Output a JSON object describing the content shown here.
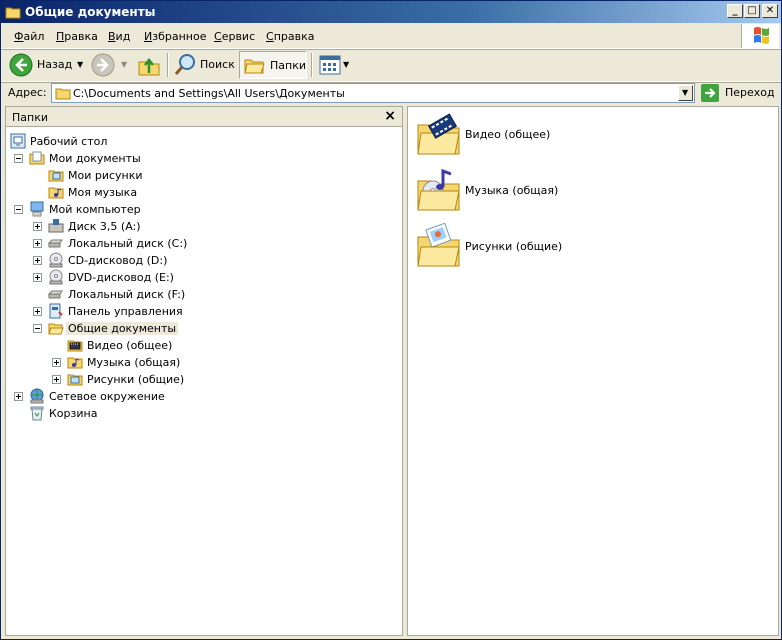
{
  "window": {
    "title": "Общие документы"
  },
  "menu": [
    "Файл",
    "Правка",
    "Вид",
    "Избранное",
    "Сервис",
    "Справка"
  ],
  "toolbar": {
    "back_label": "Назад",
    "search_label": "Поиск",
    "folders_label": "Папки"
  },
  "address": {
    "label": "Адрес:",
    "value": "C:\\Documents and Settings\\All Users\\Документы",
    "go_label": "Переход"
  },
  "folders_panel": {
    "title": "Папки",
    "tree": [
      {
        "label": "Рабочий стол",
        "icon": "desktop-icon"
      },
      {
        "label": "Мои документы",
        "icon": "my-documents-icon"
      },
      {
        "label": "Мои рисунки",
        "icon": "my-pictures-folder-icon"
      },
      {
        "label": "Моя музыка",
        "icon": "my-music-folder-icon"
      },
      {
        "label": "Мой компьютер",
        "icon": "my-computer-icon"
      },
      {
        "label": "Диск 3,5 (A:)",
        "icon": "floppy-drive-icon"
      },
      {
        "label": "Локальный диск (C:)",
        "icon": "hard-drive-icon"
      },
      {
        "label": "CD-дисковод (D:)",
        "icon": "cd-drive-icon"
      },
      {
        "label": "DVD-дисковод (E:)",
        "icon": "dvd-drive-icon"
      },
      {
        "label": "Локальный диск (F:)",
        "icon": "hard-drive-icon"
      },
      {
        "label": "Панель управления",
        "icon": "control-panel-icon"
      },
      {
        "label": "Общие документы",
        "icon": "open-folder-icon"
      },
      {
        "label": "Видео (общее)",
        "icon": "video-folder-icon"
      },
      {
        "label": "Музыка (общая)",
        "icon": "music-folder-icon"
      },
      {
        "label": "Рисунки (общие)",
        "icon": "pictures-folder-icon"
      },
      {
        "label": "Сетевое окружение",
        "icon": "network-icon"
      },
      {
        "label": "Корзина",
        "icon": "recycle-bin-icon"
      }
    ]
  },
  "content": {
    "items": [
      {
        "label": "Видео (общее)",
        "icon": "video-folder-icon"
      },
      {
        "label": "Музыка (общая)",
        "icon": "music-folder-icon"
      },
      {
        "label": "Рисунки (общие)",
        "icon": "pictures-folder-icon"
      }
    ]
  }
}
